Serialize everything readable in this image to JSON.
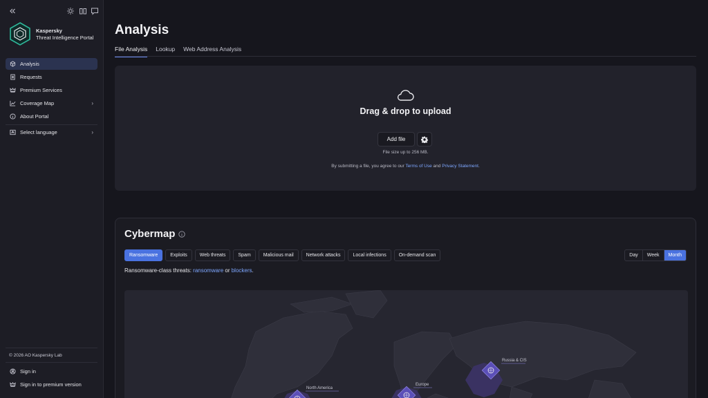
{
  "sidebar": {
    "brand": {
      "line1": "Kaspersky",
      "line2": "Threat Intelligence Portal"
    },
    "top_icons": [
      "collapse-icon",
      "sun-icon",
      "book-icon",
      "chat-icon"
    ],
    "nav": [
      {
        "label": "Analysis",
        "icon": "cube-icon",
        "active": true
      },
      {
        "label": "Requests",
        "icon": "document-icon"
      },
      {
        "label": "Premium Services",
        "icon": "crown-icon"
      },
      {
        "label": "Coverage Map",
        "icon": "chart-icon",
        "has_submenu": true
      },
      {
        "label": "About Portal",
        "icon": "info-icon"
      }
    ],
    "language": {
      "label": "Select language",
      "icon": "translate-icon"
    },
    "copyright": "© 2026 AO Kaspersky Lab",
    "footer": [
      {
        "label": "Sign in",
        "icon": "user-icon"
      },
      {
        "label": "Sign in to premium version",
        "icon": "crown-icon"
      }
    ]
  },
  "main": {
    "title": "Analysis",
    "tabs": [
      {
        "label": "File Analysis",
        "active": true
      },
      {
        "label": "Lookup"
      },
      {
        "label": "Web Address Analysis"
      }
    ],
    "upload": {
      "title": "Drag & drop to upload",
      "add_file": "Add file",
      "size_note": "File size up to 256 MB.",
      "terms_prefix": "By submitting a file, you agree to our ",
      "terms_link": "Terms of Use",
      "terms_and": " and ",
      "privacy_link": "Privacy Statement",
      "terms_suffix": "."
    },
    "cybermap": {
      "title": "Cybermap",
      "filters": [
        {
          "label": "Ransomware",
          "active": true
        },
        {
          "label": "Exploits"
        },
        {
          "label": "Web threats"
        },
        {
          "label": "Spam"
        },
        {
          "label": "Malicious mail"
        },
        {
          "label": "Network attacks"
        },
        {
          "label": "Local infections"
        },
        {
          "label": "On-demand scan"
        }
      ],
      "periods": [
        {
          "label": "Day"
        },
        {
          "label": "Week"
        },
        {
          "label": "Month",
          "active": true
        }
      ],
      "desc_prefix": "Ransomware-class threats: ",
      "desc_link1": "ransomware",
      "desc_or": " or ",
      "desc_link2": "blockers",
      "desc_suffix": ".",
      "regions": [
        "Russia & CIS",
        "North America",
        "Europe"
      ]
    }
  },
  "colors": {
    "accent": "#4a72e0",
    "link": "#7ea7ff",
    "background": "#16161d",
    "sidebar": "#1d1d25",
    "active_nav": "#2b3350",
    "marker": "#7b6fd8"
  }
}
